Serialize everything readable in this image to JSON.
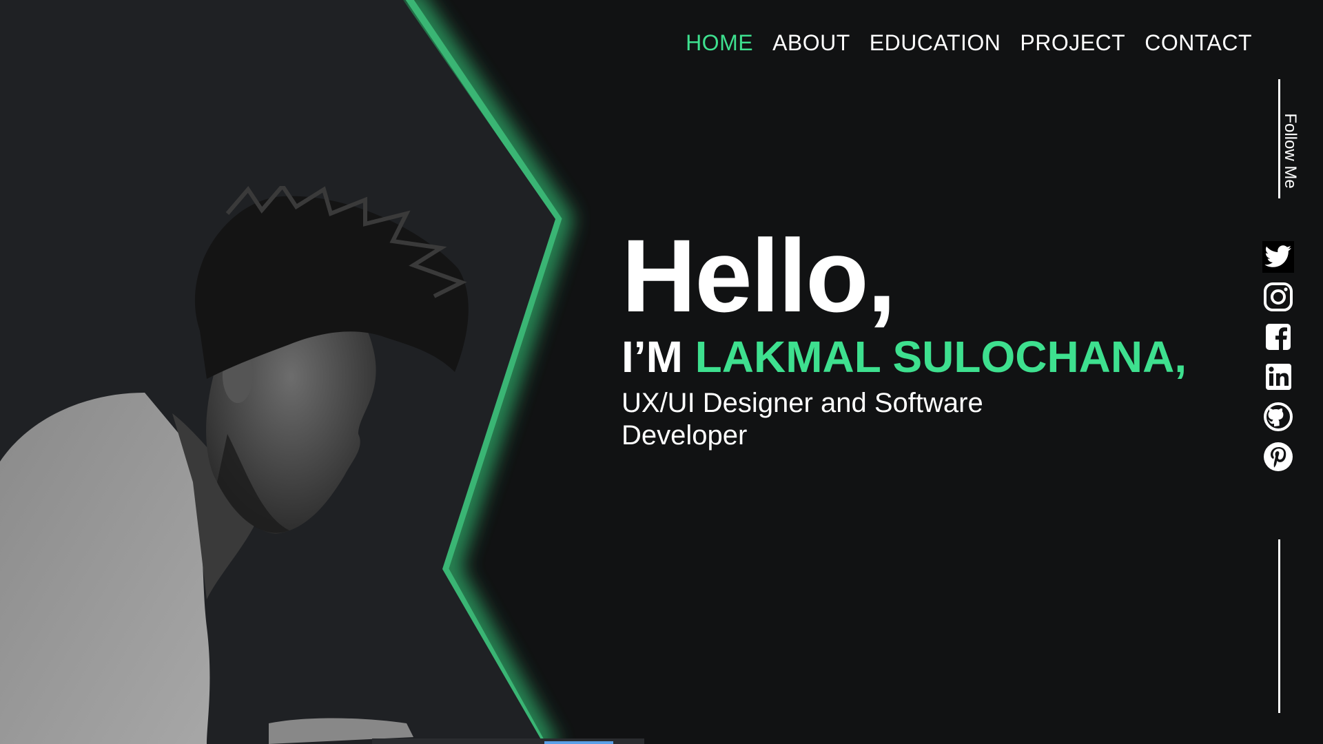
{
  "nav": {
    "items": [
      {
        "label": "HOME",
        "active": true
      },
      {
        "label": "ABOUT",
        "active": false
      },
      {
        "label": "EDUCATION",
        "active": false
      },
      {
        "label": "PROJECT",
        "active": false
      },
      {
        "label": "CONTACT",
        "active": false
      }
    ]
  },
  "hero": {
    "greeting": "Hello,",
    "name_prefix": "I’M ",
    "name": "LAKMAL SULOCHANA,",
    "role": "UX/UI Designer and Software Developer"
  },
  "follow": {
    "label": "Follow Me",
    "icons": [
      "twitter-icon",
      "instagram-icon",
      "facebook-icon",
      "linkedin-icon",
      "github-icon",
      "pinterest-icon"
    ]
  },
  "colors": {
    "accent": "#3ee08f",
    "background": "#111213",
    "panel": "#1f2124",
    "text": "#ffffff"
  }
}
